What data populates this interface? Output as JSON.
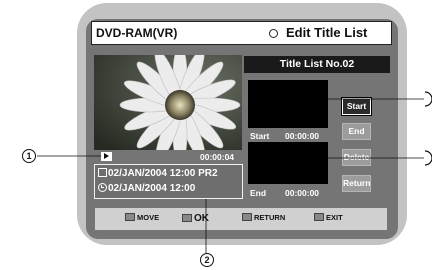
{
  "title_bar": {
    "mode": "DVD-RAM(VR)",
    "title": "Edit Title List"
  },
  "preview": {
    "playback_time": "00:00:04"
  },
  "info": {
    "line1": "02/JAN/2004 12:00 PR2",
    "line2": "02/JAN/2004 12:00"
  },
  "title_list": {
    "label": "Title List No.02",
    "start_label": "Start",
    "start_time": "00:00:00",
    "end_label": "End",
    "end_time": "00:00:00"
  },
  "buttons": {
    "start": "Start",
    "end": "End",
    "delete": "Delete",
    "return": "Return"
  },
  "bottom_hints": {
    "move": "MOVE",
    "ok": "OK",
    "return": "RETURN",
    "exit": "EXIT"
  },
  "callouts": {
    "one": "1",
    "two": "2"
  },
  "colors": {
    "screen_bg": "#757575",
    "frame": "#c3c3c3",
    "active_button": "#2b2b2b",
    "inactive_button": "#9c9c9c"
  }
}
